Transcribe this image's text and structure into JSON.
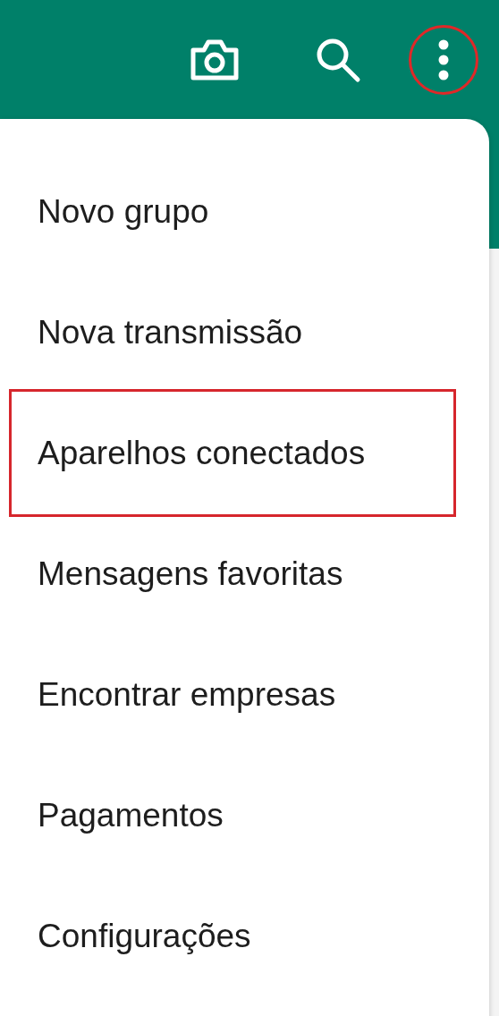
{
  "toolbar": {
    "buttons": [
      {
        "kind": "camera",
        "circled": false
      },
      {
        "kind": "search",
        "circled": false
      },
      {
        "kind": "more",
        "circled": true
      }
    ]
  },
  "menu": {
    "items": [
      {
        "label": "Novo grupo",
        "highlighted": false
      },
      {
        "label": "Nova transmissão",
        "highlighted": false
      },
      {
        "label": "Aparelhos conectados",
        "highlighted": true
      },
      {
        "label": "Mensagens favoritas",
        "highlighted": false
      },
      {
        "label": "Encontrar empresas",
        "highlighted": false
      },
      {
        "label": "Pagamentos",
        "highlighted": false
      },
      {
        "label": "Configurações",
        "highlighted": false
      }
    ]
  }
}
